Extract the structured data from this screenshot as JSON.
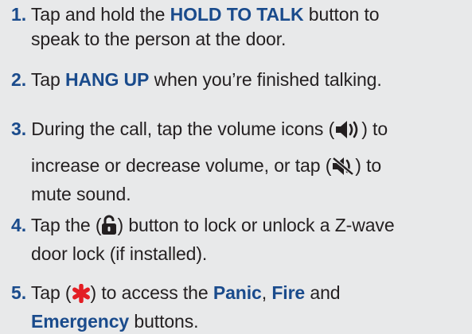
{
  "steps": [
    {
      "number": "1.",
      "t1": "Tap and hold the ",
      "b1": "HOLD TO TALK",
      "t2": " button to",
      "line2": "speak to the person at the door."
    },
    {
      "number": "2.",
      "t1": " Tap ",
      "b1": "HANG UP",
      "t2": " when you’re finished talking."
    },
    {
      "number": "3.",
      "t1": " During the call, tap the volume icons (",
      "t2": ") to",
      "line2a": "increase or decrease volume, or tap (",
      "line2b": ") to",
      "line3": "mute sound."
    },
    {
      "number": "4.",
      "t1": " Tap the (",
      "t2": ") button to lock or unlock a Z-wave",
      "line2": "door lock (if installed)."
    },
    {
      "number": "5.",
      "t1": " Tap (",
      "t2": ") to access the ",
      "b1": "Panic",
      "t3": ", ",
      "b2": "Fire",
      "t4": " and",
      "b3": "Emergency",
      "t5": " buttons."
    }
  ],
  "icons": {
    "volume": "speaker-volume-icon",
    "mute": "speaker-mute-icon",
    "lock": "padlock-unlocked-icon",
    "panic": "asterisk-panic-icon"
  },
  "colors": {
    "background": "#e8e9ea",
    "text": "#231f20",
    "highlight": "#1a4b8c",
    "panic": "#e31e24"
  }
}
